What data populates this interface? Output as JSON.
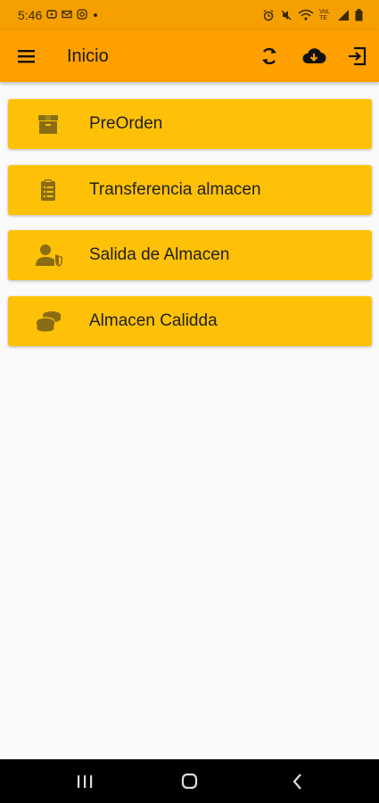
{
  "status_bar": {
    "time": "5:46",
    "left_icons": [
      "whatsapp-icon",
      "mail-icon",
      "instagram-icon",
      "dot-icon"
    ],
    "right_icons": [
      "alarm-icon",
      "mute-icon",
      "wifi-icon",
      "signal-icon",
      "battery-icon"
    ],
    "network_label": "VoLTE"
  },
  "app_bar": {
    "title": "Inicio",
    "actions": [
      "sync-icon",
      "cloud-download-icon",
      "logout-icon"
    ]
  },
  "menu": {
    "items": [
      {
        "label": "PreOrden",
        "icon": "box-icon"
      },
      {
        "label": "Transferencia almacen",
        "icon": "clipboard-icon"
      },
      {
        "label": "Salida de Almacen",
        "icon": "user-shield-icon"
      },
      {
        "label": "Almacen Calidda",
        "icon": "coins-icon"
      }
    ]
  },
  "colors": {
    "status_bar": "#f5a000",
    "app_bar": "#ffa000",
    "card": "#ffc107",
    "icon": "#8a6d12",
    "background": "#fafafa"
  },
  "nav_bar": {
    "buttons": [
      "recent-apps-icon",
      "home-icon",
      "back-icon"
    ]
  }
}
